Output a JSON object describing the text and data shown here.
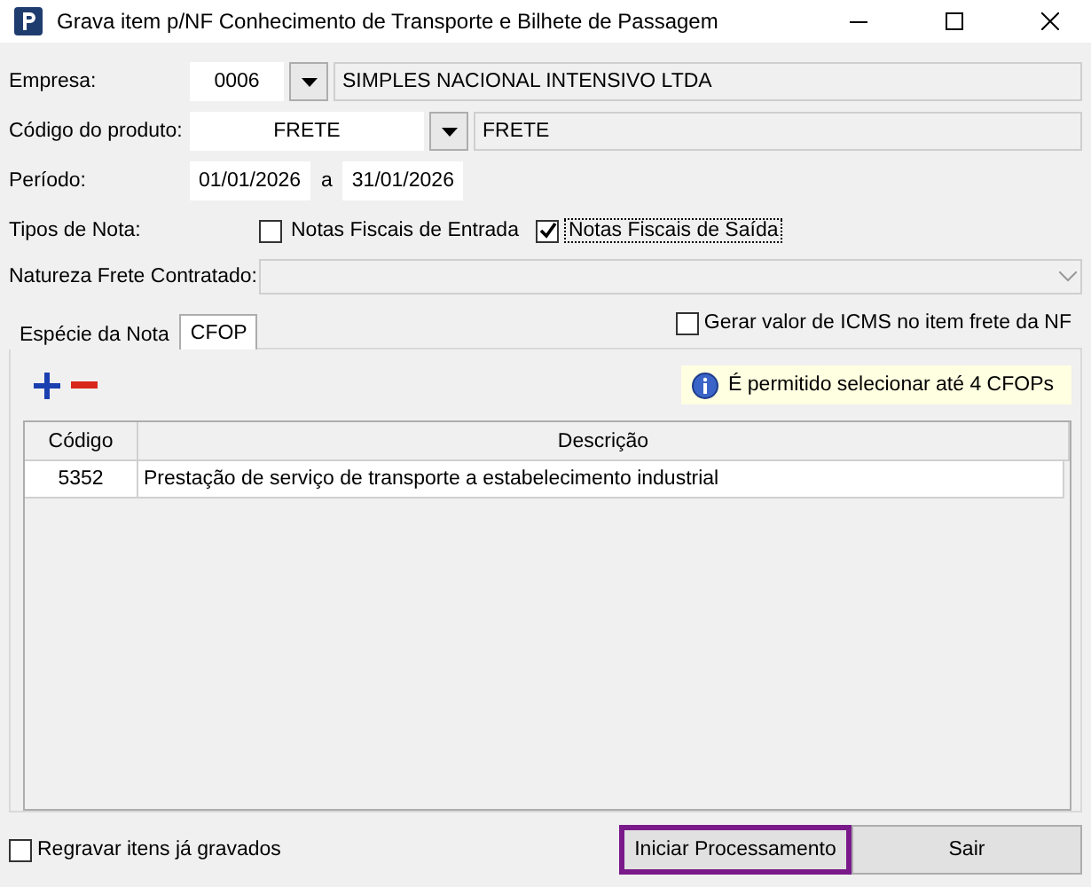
{
  "window": {
    "title": "Grava item p/NF Conhecimento de Transporte e Bilhete de Passagem"
  },
  "empresa": {
    "label": "Empresa:",
    "code": "0006",
    "name": "SIMPLES NACIONAL INTENSIVO LTDA"
  },
  "produto": {
    "label": "Código do produto:",
    "code": "FRETE",
    "name": "FRETE"
  },
  "periodo": {
    "label": "Período:",
    "start": "01/01/2026",
    "separator": "a",
    "end": "31/01/2026"
  },
  "tipos_nota": {
    "label": "Tipos de Nota:",
    "options": [
      {
        "label": "Notas Fiscais de Entrada",
        "checked": false,
        "focused": false
      },
      {
        "label": "Notas Fiscais de Saída",
        "checked": true,
        "focused": true
      }
    ]
  },
  "natureza": {
    "label": "Natureza Frete Contratado:"
  },
  "tabs": [
    {
      "label": "Espécie da Nota",
      "selected": false
    },
    {
      "label": "CFOP",
      "selected": true
    }
  ],
  "gerar_icms": {
    "label": "Gerar valor de ICMS no item frete da NF",
    "checked": false
  },
  "info": "É permitido selecionar até 4 CFOPs",
  "table": {
    "columns": [
      "Código",
      "Descrição"
    ],
    "rows": [
      [
        "5352",
        "Prestação de serviço de transporte a estabelecimento industrial"
      ]
    ]
  },
  "regravar": {
    "label": "Regravar itens já gravados",
    "checked": false
  },
  "buttons": [
    {
      "label": "Iniciar Processamento",
      "focused": true
    },
    {
      "label": "Sair",
      "focused": false
    }
  ]
}
